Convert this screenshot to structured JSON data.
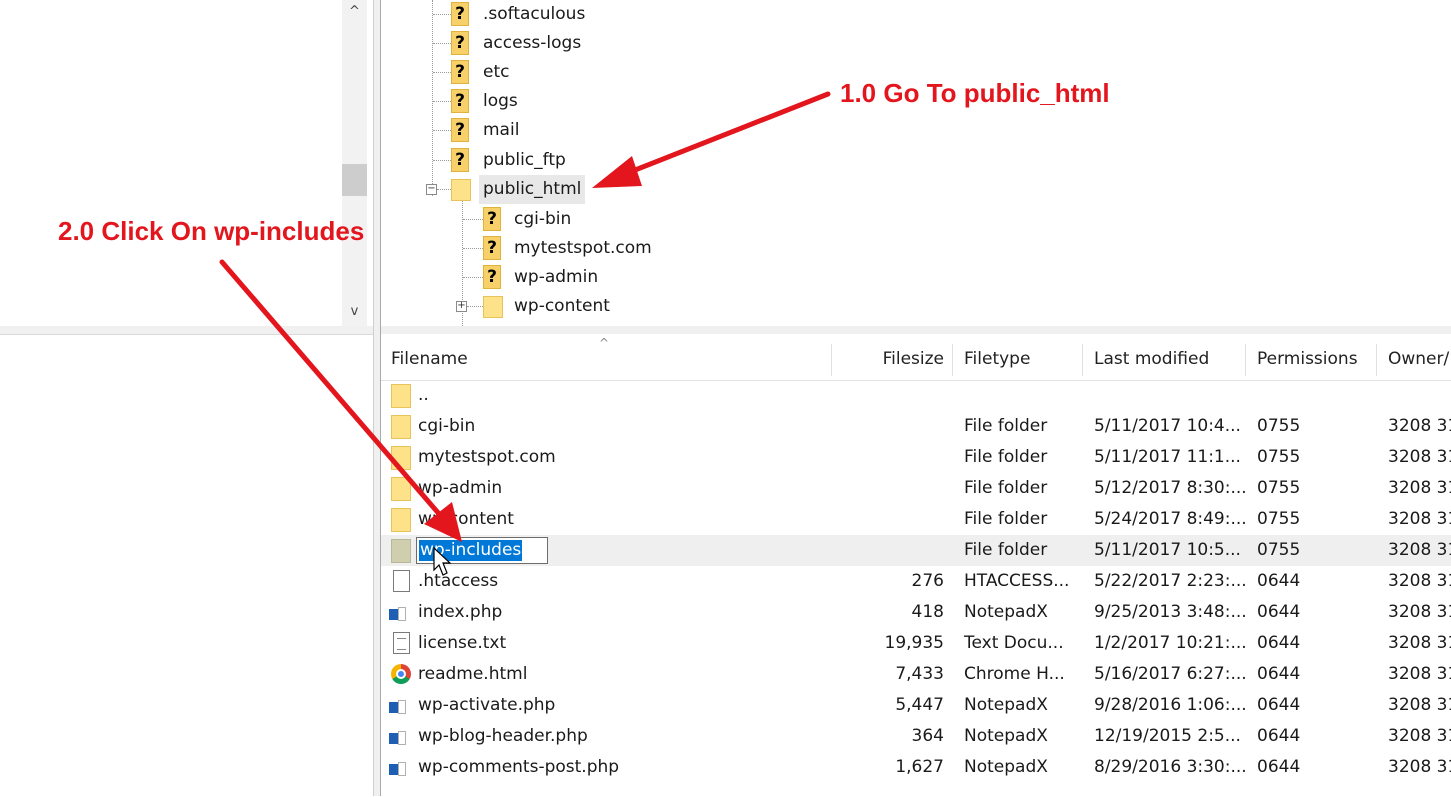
{
  "tree": {
    "items": [
      {
        "label": ".softaculous",
        "icon": "unknown-folder"
      },
      {
        "label": "access-logs",
        "icon": "unknown-folder"
      },
      {
        "label": "etc",
        "icon": "unknown-folder"
      },
      {
        "label": "logs",
        "icon": "unknown-folder"
      },
      {
        "label": "mail",
        "icon": "unknown-folder"
      },
      {
        "label": "public_ftp",
        "icon": "unknown-folder"
      },
      {
        "label": "public_html",
        "icon": "folder",
        "expander": "⊟"
      },
      {
        "label": "cgi-bin",
        "icon": "unknown-folder"
      },
      {
        "label": "mytestspot.com",
        "icon": "unknown-folder"
      },
      {
        "label": "wp-admin",
        "icon": "unknown-folder"
      },
      {
        "label": "wp-content",
        "icon": "folder",
        "expander": "⊞"
      }
    ],
    "question_mark": "?",
    "scroll_up": "^",
    "scroll_down": "v"
  },
  "filelist": {
    "columns": [
      "Filename",
      "Filesize",
      "Filetype",
      "Last modified",
      "Permissions",
      "Owner/"
    ],
    "sort_caret": "^",
    "rows": [
      {
        "name": "..",
        "size": "",
        "type": "",
        "modified": "",
        "perms": "",
        "owner": "",
        "icon": "folder"
      },
      {
        "name": "cgi-bin",
        "size": "",
        "type": "File folder",
        "modified": "5/11/2017 10:4...",
        "perms": "0755",
        "owner": "3208 31",
        "icon": "folder"
      },
      {
        "name": "mytestspot.com",
        "size": "",
        "type": "File folder",
        "modified": "5/11/2017 11:1...",
        "perms": "0755",
        "owner": "3208 31",
        "icon": "folder"
      },
      {
        "name": "wp-admin",
        "size": "",
        "type": "File folder",
        "modified": "5/12/2017 8:30:...",
        "perms": "0755",
        "owner": "3208 31",
        "icon": "folder"
      },
      {
        "name": "wp-content",
        "size": "",
        "type": "File folder",
        "modified": "5/24/2017 8:49:...",
        "perms": "0755",
        "owner": "3208 31",
        "icon": "folder"
      },
      {
        "name": "wp-includes",
        "size": "",
        "type": "File folder",
        "modified": "5/11/2017 10:5...",
        "perms": "0755",
        "owner": "3208 31",
        "icon": "folder-selected"
      },
      {
        "name": ".htaccess",
        "size": "276",
        "type": "HTACCESS...",
        "modified": "5/22/2017 2:23:...",
        "perms": "0644",
        "owner": "3208 31",
        "icon": "file"
      },
      {
        "name": "index.php",
        "size": "418",
        "type": "NotepadX",
        "modified": "9/25/2013 3:48:...",
        "perms": "0644",
        "owner": "3208 31",
        "icon": "php"
      },
      {
        "name": "license.txt",
        "size": "19,935",
        "type": "Text Docu...",
        "modified": "1/2/2017 10:21:...",
        "perms": "0644",
        "owner": "3208 31",
        "icon": "text"
      },
      {
        "name": "readme.html",
        "size": "7,433",
        "type": "Chrome H...",
        "modified": "5/16/2017 6:27:...",
        "perms": "0644",
        "owner": "3208 31",
        "icon": "chrome"
      },
      {
        "name": "wp-activate.php",
        "size": "5,447",
        "type": "NotepadX",
        "modified": "9/28/2016 1:06:...",
        "perms": "0644",
        "owner": "3208 31",
        "icon": "php"
      },
      {
        "name": "wp-blog-header.php",
        "size": "364",
        "type": "NotepadX",
        "modified": "12/19/2015 2:5...",
        "perms": "0644",
        "owner": "3208 31",
        "icon": "php"
      },
      {
        "name": "wp-comments-post.php",
        "size": "1,627",
        "type": "NotepadX",
        "modified": "8/29/2016 3:30:...",
        "perms": "0644",
        "owner": "3208 31",
        "icon": "php"
      }
    ]
  },
  "annotations": {
    "step1": "1.0 Go To public_html",
    "step2": "2.0 Click On wp-includes",
    "color": "#e3161e"
  }
}
